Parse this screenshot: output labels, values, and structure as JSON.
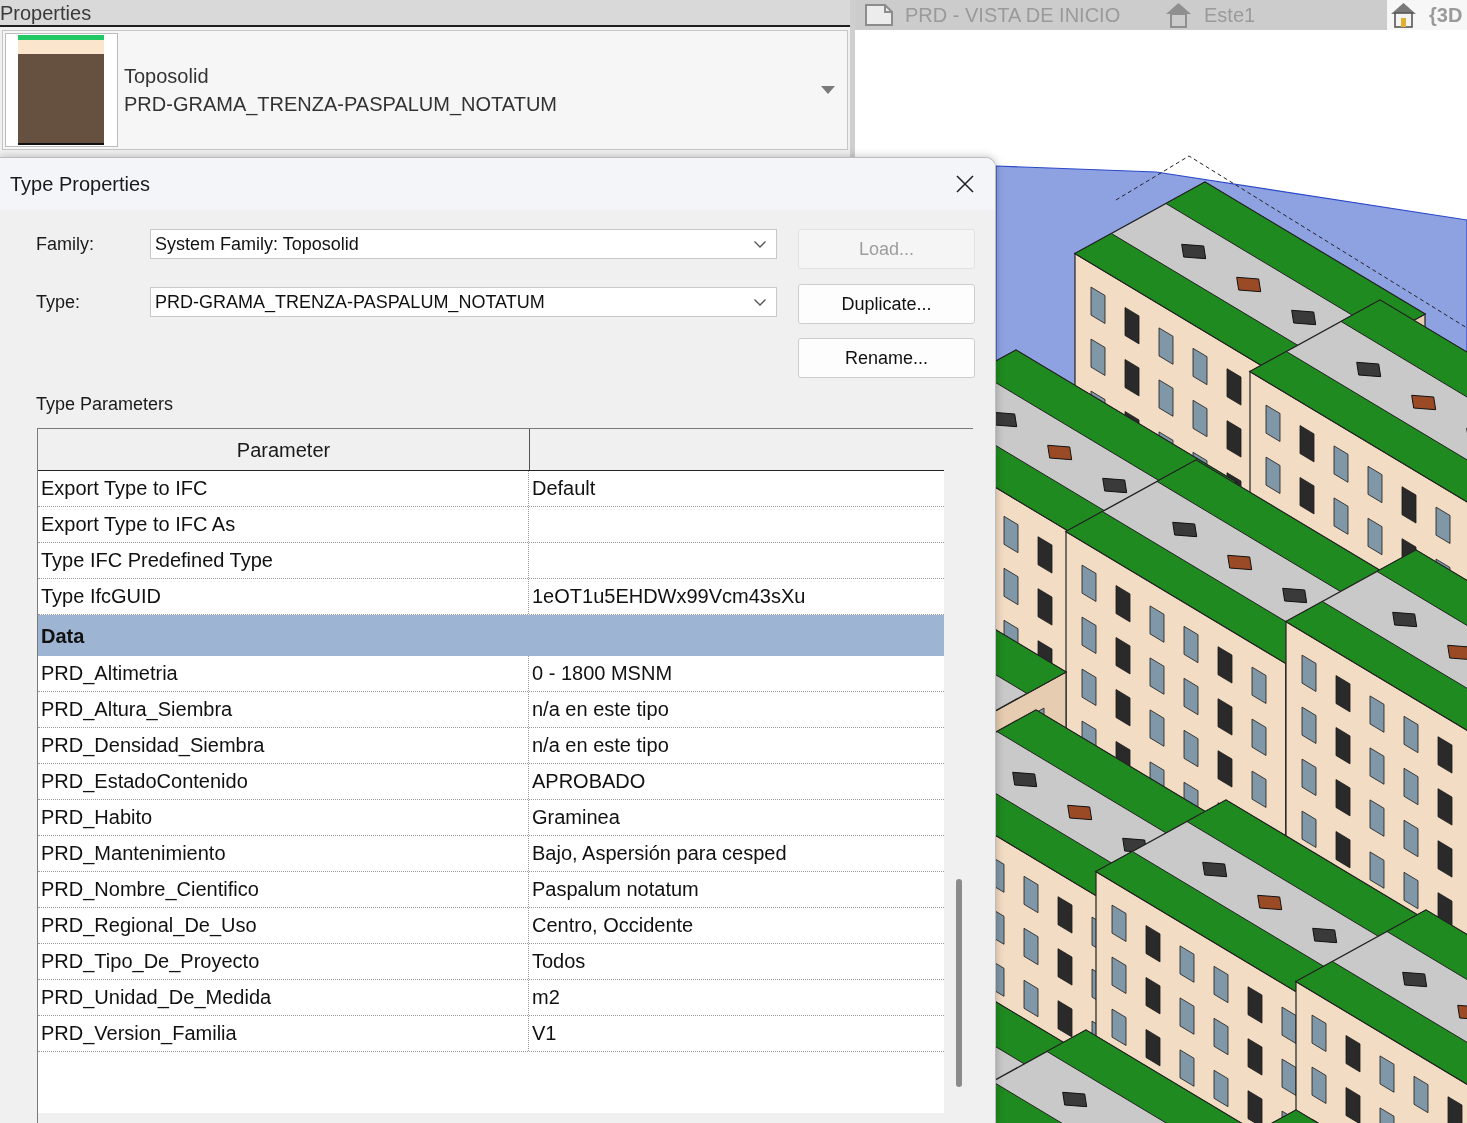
{
  "properties_panel": {
    "title": "Properties",
    "type_selector": {
      "category": "Toposolid",
      "type_name": "PRD-GRAMA_TRENZA-PASPALUM_NOTATUM"
    }
  },
  "view_tabs": [
    {
      "label": "PRD - VISTA DE INICIO",
      "kind": "sheet",
      "selected": false
    },
    {
      "label": "Este1",
      "kind": "elevation",
      "selected": false
    },
    {
      "label": "{3D",
      "kind": "model",
      "selected": true
    }
  ],
  "type_properties_dialog": {
    "title": "Type Properties",
    "fields": [
      {
        "label": "Family:",
        "value": "System Family: Toposolid"
      },
      {
        "label": "Type:",
        "value": "PRD-GRAMA_TRENZA-PASPALUM_NOTATUM"
      }
    ],
    "buttons": [
      {
        "label": "Load...",
        "disabled": true
      },
      {
        "label": "Duplicate...",
        "disabled": false
      },
      {
        "label": "Rename...",
        "disabled": false
      }
    ],
    "section_title": "Type Parameters",
    "table": {
      "columns": [
        "Parameter"
      ],
      "rows": [
        {
          "kind": "param",
          "name": "Export Type to IFC",
          "value": "Default"
        },
        {
          "kind": "param",
          "name": "Export Type to IFC As"
        },
        {
          "kind": "param",
          "name": "Type IFC Predefined Type"
        },
        {
          "kind": "param",
          "name": "Type IfcGUID",
          "value": "1eOT1u5EHDWx99Vcm43sXu"
        },
        {
          "kind": "group",
          "name": "Data"
        },
        {
          "kind": "param",
          "name": "PRD_Altimetria",
          "value": "0 - 1800 MSNM"
        },
        {
          "kind": "param",
          "name": "PRD_Altura_Siembra",
          "value": "n/a en este tipo"
        },
        {
          "kind": "param",
          "name": "PRD_Densidad_Siembra",
          "value": "n/a en este tipo"
        },
        {
          "kind": "param",
          "name": "PRD_EstadoContenido",
          "value": "APROBADO"
        },
        {
          "kind": "param",
          "name": "PRD_Habito",
          "value": "Graminea"
        },
        {
          "kind": "param",
          "name": "PRD_Mantenimiento",
          "value": "Bajo, Aspersión para cesped"
        },
        {
          "kind": "param",
          "name": "PRD_Nombre_Cientifico",
          "value": "Paspalum notatum"
        },
        {
          "kind": "param",
          "name": "PRD_Regional_De_Uso",
          "value": "Centro, Occidente"
        },
        {
          "kind": "param",
          "name": "PRD_Tipo_De_Proyecto",
          "value": "Todos"
        },
        {
          "kind": "param",
          "name": "PRD_Unidad_De_Medida",
          "value": "m2"
        },
        {
          "kind": "param",
          "name": "PRD_Version_Familia",
          "value": "V1"
        }
      ]
    }
  }
}
